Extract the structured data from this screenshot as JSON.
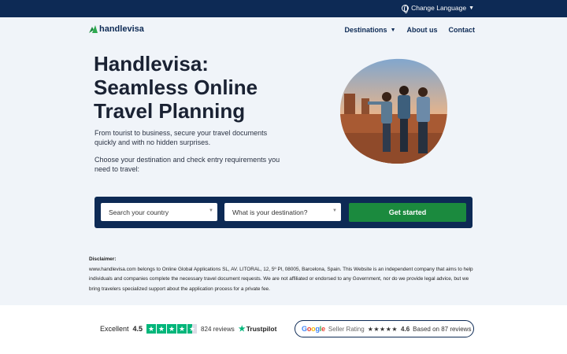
{
  "topbar": {
    "language_label": "Change Language"
  },
  "header": {
    "logo_text": "handlevisa",
    "nav": {
      "destinations": "Destinations",
      "about": "About us",
      "contact": "Contact"
    }
  },
  "hero": {
    "title": "Handlevisa: Seamless Online Travel Planning",
    "subtitle": "From tourist to business, secure your travel documents quickly and with no hidden surprises.",
    "subtitle2": "Choose your destination and check entry requirements you need to travel:"
  },
  "search": {
    "country_placeholder": "Search your country",
    "destination_placeholder": "What is your destination?",
    "cta_label": "Get started"
  },
  "disclaimer": {
    "title": "Disclaimer:",
    "text": "www.handlevisa.com belongs to Online Global Applications SL, AV. LITORAL, 12, 5º Pl, 08005, Barcelona, Spain. This Website is an independent company that aims to help individuals and companies complete the necessary travel document requests. We are not affiliated or endorsed to any Government, nor do we provide legal advice, but we bring travelers specialized support about the application process for a private fee."
  },
  "trustpilot": {
    "label": "Excellent",
    "score": "4.5",
    "reviews": "824 reviews",
    "brand": "Trustpilot",
    "rating": 4.5
  },
  "google": {
    "logo": "Google",
    "label": "Seller Rating",
    "stars": "★★★★★",
    "score": "4.6",
    "reviews": "Based on 87 reviews"
  },
  "colors": {
    "navy": "#0d2a55",
    "green": "#1b8a3e",
    "trustpilot_green": "#00b67a"
  },
  "icons": [
    "globe-icon",
    "caret-down-icon",
    "logo-icon",
    "select-arrow-icon",
    "trustpilot-star-icon"
  ]
}
